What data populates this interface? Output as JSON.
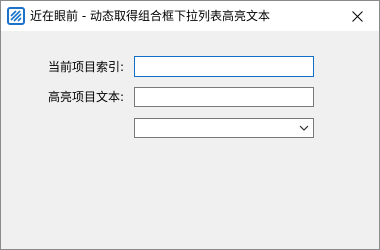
{
  "window": {
    "title": "近在眼前 - 动态取得组合框下拉列表高亮文本",
    "app_icon": "hatched-square-icon",
    "close_icon": "close-icon"
  },
  "form": {
    "index_label": "当前项目索引:",
    "index_value": "",
    "text_label": "高亮项目文本:",
    "text_value": "",
    "combo_value": "",
    "combo_icon": "chevron-down-icon"
  },
  "colors": {
    "focus_border": "#0f6fc6",
    "icon_blue": "#1a73c8"
  }
}
